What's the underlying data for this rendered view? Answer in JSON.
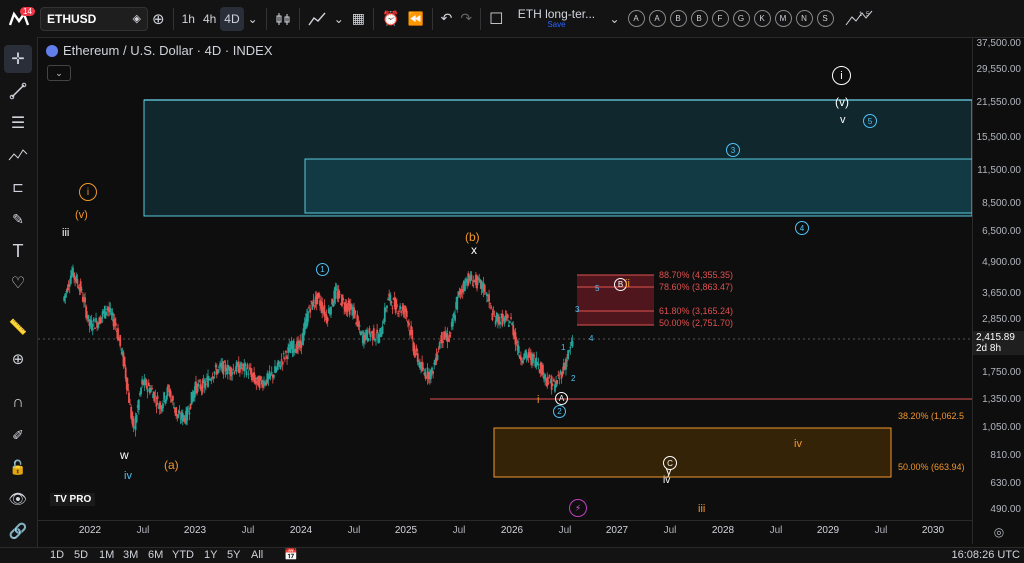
{
  "app": {
    "badge": "14",
    "symbol": "ETHUSD"
  },
  "timeframes": {
    "tf1": "1h",
    "tf2": "4h",
    "tf3": "4D"
  },
  "layout": {
    "name": "ETH long-ter...",
    "save": "Save"
  },
  "alerts": [
    "A",
    "A",
    "B",
    "B",
    "F",
    "G",
    "K",
    "M",
    "N",
    "S"
  ],
  "legend": {
    "title": "Ethereum / U.S. Dollar · 4D · INDEX"
  },
  "price_axis": {
    "labels": [
      "37,500.00",
      "29,550.00",
      "21,550.00",
      "15,500.00",
      "11,500.00",
      "8,500.00",
      "6,500.00",
      "4,900.00",
      "3,650.00",
      "2,850.00",
      "1,750.00",
      "1,350.00",
      "1,050.00",
      "810.00",
      "630.00",
      "490.00"
    ],
    "current": "2,415.89",
    "countdown": "2d 8h"
  },
  "time_axis": {
    "labels": [
      "2022",
      "Jul",
      "2023",
      "Jul",
      "2024",
      "Jul",
      "2025",
      "Jul",
      "2026",
      "Jul",
      "2027",
      "Jul",
      "2028",
      "Jul",
      "2029",
      "Jul",
      "2030"
    ]
  },
  "fib_upper": [
    "88.70% (4,355.35)",
    "78.60% (3,863.47)",
    "61.80% (3,165.24)",
    "50.00% (2,751.70)"
  ],
  "fib_lower": [
    "38.20% (1,062.5",
    "50.00% (663.94)"
  ],
  "waves": {
    "i_top": "i",
    "v_paren_top": "(v)",
    "v_top": "v",
    "c3": "3",
    "c4": "4",
    "c5": "5",
    "i_orange": "i",
    "v_orange": "(v)",
    "iii": "iii",
    "c1": "1",
    "b_paren": "(b)",
    "x": "x",
    "B": "B",
    "ii": "ii",
    "s5": "5",
    "s3": "3",
    "s1": "1",
    "s4": "4",
    "s2": "2",
    "A": "A",
    "c2": "2",
    "i_small": "i",
    "w": "w",
    "iv_teal": "iv",
    "a_paren": "(a)",
    "iv_orange": "iv",
    "C": "C",
    "y": "y",
    "iv_white": "iv",
    "iii_orange": "iii"
  },
  "bottom": {
    "ranges": [
      "1D",
      "5D",
      "1M",
      "3M",
      "6M",
      "YTD",
      "1Y",
      "5Y",
      "All"
    ],
    "time": "16:08:26 UTC"
  },
  "logo": "TV PRO",
  "colors": {
    "teal": "#4fc3f7",
    "orange": "#f0962e",
    "red": "#e05050",
    "up": "#26a69a",
    "down": "#ef5350"
  },
  "chart_data": {
    "type": "candlestick",
    "scale": "log",
    "ylim": [
      490,
      37500
    ],
    "x": [
      "2021-10",
      "2021-11",
      "2021-12",
      "2022-01",
      "2022-02",
      "2022-03",
      "2022-04",
      "2022-05",
      "2022-06",
      "2022-07",
      "2022-08",
      "2022-09",
      "2022-10",
      "2022-11",
      "2022-12",
      "2023-01",
      "2023-02",
      "2023-03",
      "2023-04",
      "2023-05",
      "2023-06",
      "2023-07",
      "2023-08",
      "2023-09",
      "2023-10",
      "2023-11",
      "2023-12",
      "2024-01",
      "2024-02",
      "2024-03",
      "2024-04",
      "2024-05",
      "2024-06",
      "2024-07",
      "2024-08",
      "2024-09",
      "2024-10",
      "2024-11",
      "2024-12",
      "2025-01",
      "2025-02",
      "2025-03",
      "2025-04",
      "2025-05",
      "2025-06",
      "2025-07",
      "2025-08",
      "2025-09",
      "2025-10",
      "2025-11",
      "2025-12",
      "2026-01",
      "2026-02",
      "2026-03",
      "2026-04",
      "2026-05",
      "2026-06",
      "2026-07",
      "2026-08"
    ],
    "close": [
      3500,
      4600,
      3900,
      2800,
      2900,
      3300,
      2800,
      1900,
      1050,
      1650,
      1550,
      1320,
      1550,
      1200,
      1200,
      1580,
      1600,
      1800,
      1900,
      1850,
      1900,
      1860,
      1650,
      1670,
      1800,
      2050,
      2300,
      2300,
      3300,
      3600,
      3000,
      3800,
      3400,
      3200,
      2500,
      2600,
      2500,
      3600,
      3300,
      3200,
      2200,
      1800,
      1800,
      2500,
      2500,
      3700,
      4300,
      4200,
      3900,
      3000,
      2950,
      2900,
      2100,
      2100,
      2000,
      1700,
      1600,
      1900,
      2416
    ]
  }
}
